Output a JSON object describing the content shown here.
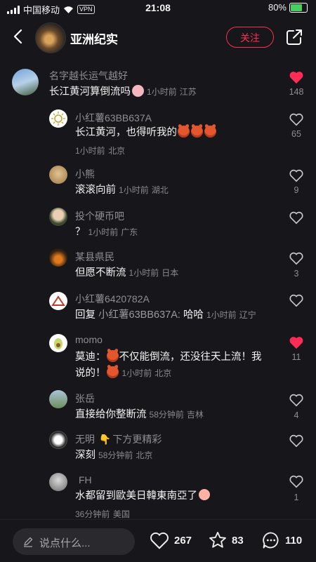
{
  "status_bar": {
    "carrier": "中国移动",
    "vpn": "VPN",
    "time": "21:08",
    "battery": "80%",
    "battery_level": 0.8
  },
  "header": {
    "title": "亚洲纪实",
    "follow_label": "关注"
  },
  "comments": [
    {
      "user": "名字越长运气越好",
      "text": "长江黄河算倒流吗",
      "time": "1小时前",
      "location": "江苏",
      "likes": "148",
      "liked": true
    },
    {
      "user": "小红薯63BB637A",
      "text": "长江黄河，也得听我的",
      "time": "1小时前",
      "location": "北京",
      "likes": "65",
      "liked": false
    },
    {
      "user": "小熊",
      "text": "滚滚向前",
      "time": "1小时前",
      "location": "湖北",
      "likes": "9",
      "liked": false
    },
    {
      "user": "投个硬币吧",
      "text": "？",
      "time": "1小时前",
      "location": "广东",
      "likes": "",
      "liked": false
    },
    {
      "user": "某县県民",
      "text": "但愿不断流",
      "time": "1小时前",
      "location": "日本",
      "likes": "3",
      "liked": false
    },
    {
      "user": "小红薯6420782A",
      "text_prefix": "回复",
      "reply_to": "小红薯63BB637A:",
      "text": "哈哈",
      "time": "1小时前",
      "location": "辽宁",
      "likes": "",
      "liked": false
    },
    {
      "user": "momo",
      "text_a": "莫迪：",
      "text_b": "不仅能倒流，还没往天上流！我",
      "text_c": "说的！",
      "time": "1小时前",
      "location": "北京",
      "likes": "11",
      "liked": true
    },
    {
      "user": "张岳",
      "text": "直接给你整断流",
      "time": "58分钟前",
      "location": "吉林",
      "likes": "4",
      "liked": false
    },
    {
      "user": "无明",
      "user_suffix": "下方更精彩",
      "text": "深刻",
      "time": "58分钟前",
      "location": "北京",
      "likes": "",
      "liked": false
    },
    {
      "user": "FH",
      "text": "水都留到歐美日韓東南亞了",
      "time": "36分钟前",
      "location": "美国",
      "likes": "1",
      "liked": false
    }
  ],
  "bottom_bar": {
    "placeholder": "说点什么...",
    "likes": "267",
    "stars": "83",
    "comments": "110"
  },
  "colors": {
    "accent": "#ff2d55",
    "background": "#17171b"
  }
}
